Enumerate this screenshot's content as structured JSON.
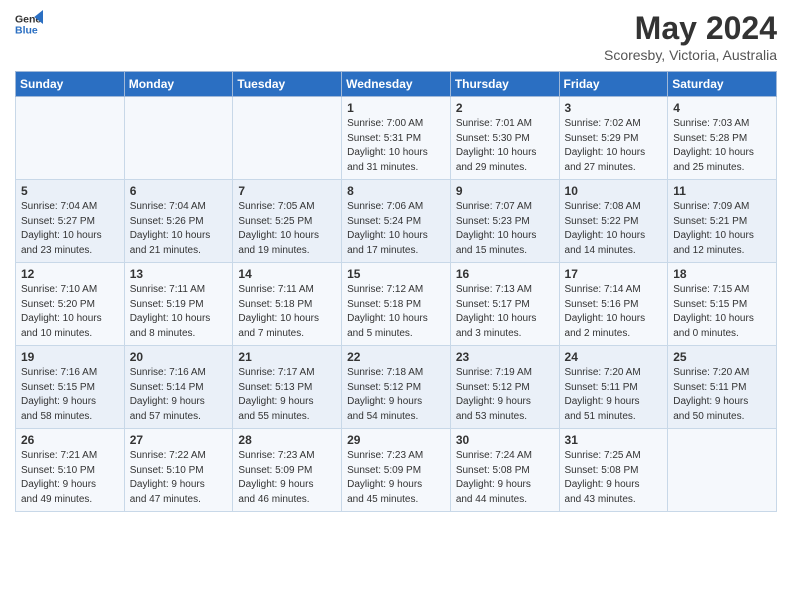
{
  "header": {
    "logo_line1": "General",
    "logo_line2": "Blue",
    "month": "May 2024",
    "location": "Scoresby, Victoria, Australia"
  },
  "days_of_week": [
    "Sunday",
    "Monday",
    "Tuesday",
    "Wednesday",
    "Thursday",
    "Friday",
    "Saturday"
  ],
  "weeks": [
    [
      {
        "day": "",
        "info": ""
      },
      {
        "day": "",
        "info": ""
      },
      {
        "day": "",
        "info": ""
      },
      {
        "day": "1",
        "info": "Sunrise: 7:00 AM\nSunset: 5:31 PM\nDaylight: 10 hours\nand 31 minutes."
      },
      {
        "day": "2",
        "info": "Sunrise: 7:01 AM\nSunset: 5:30 PM\nDaylight: 10 hours\nand 29 minutes."
      },
      {
        "day": "3",
        "info": "Sunrise: 7:02 AM\nSunset: 5:29 PM\nDaylight: 10 hours\nand 27 minutes."
      },
      {
        "day": "4",
        "info": "Sunrise: 7:03 AM\nSunset: 5:28 PM\nDaylight: 10 hours\nand 25 minutes."
      }
    ],
    [
      {
        "day": "5",
        "info": "Sunrise: 7:04 AM\nSunset: 5:27 PM\nDaylight: 10 hours\nand 23 minutes."
      },
      {
        "day": "6",
        "info": "Sunrise: 7:04 AM\nSunset: 5:26 PM\nDaylight: 10 hours\nand 21 minutes."
      },
      {
        "day": "7",
        "info": "Sunrise: 7:05 AM\nSunset: 5:25 PM\nDaylight: 10 hours\nand 19 minutes."
      },
      {
        "day": "8",
        "info": "Sunrise: 7:06 AM\nSunset: 5:24 PM\nDaylight: 10 hours\nand 17 minutes."
      },
      {
        "day": "9",
        "info": "Sunrise: 7:07 AM\nSunset: 5:23 PM\nDaylight: 10 hours\nand 15 minutes."
      },
      {
        "day": "10",
        "info": "Sunrise: 7:08 AM\nSunset: 5:22 PM\nDaylight: 10 hours\nand 14 minutes."
      },
      {
        "day": "11",
        "info": "Sunrise: 7:09 AM\nSunset: 5:21 PM\nDaylight: 10 hours\nand 12 minutes."
      }
    ],
    [
      {
        "day": "12",
        "info": "Sunrise: 7:10 AM\nSunset: 5:20 PM\nDaylight: 10 hours\nand 10 minutes."
      },
      {
        "day": "13",
        "info": "Sunrise: 7:11 AM\nSunset: 5:19 PM\nDaylight: 10 hours\nand 8 minutes."
      },
      {
        "day": "14",
        "info": "Sunrise: 7:11 AM\nSunset: 5:18 PM\nDaylight: 10 hours\nand 7 minutes."
      },
      {
        "day": "15",
        "info": "Sunrise: 7:12 AM\nSunset: 5:18 PM\nDaylight: 10 hours\nand 5 minutes."
      },
      {
        "day": "16",
        "info": "Sunrise: 7:13 AM\nSunset: 5:17 PM\nDaylight: 10 hours\nand 3 minutes."
      },
      {
        "day": "17",
        "info": "Sunrise: 7:14 AM\nSunset: 5:16 PM\nDaylight: 10 hours\nand 2 minutes."
      },
      {
        "day": "18",
        "info": "Sunrise: 7:15 AM\nSunset: 5:15 PM\nDaylight: 10 hours\nand 0 minutes."
      }
    ],
    [
      {
        "day": "19",
        "info": "Sunrise: 7:16 AM\nSunset: 5:15 PM\nDaylight: 9 hours\nand 58 minutes."
      },
      {
        "day": "20",
        "info": "Sunrise: 7:16 AM\nSunset: 5:14 PM\nDaylight: 9 hours\nand 57 minutes."
      },
      {
        "day": "21",
        "info": "Sunrise: 7:17 AM\nSunset: 5:13 PM\nDaylight: 9 hours\nand 55 minutes."
      },
      {
        "day": "22",
        "info": "Sunrise: 7:18 AM\nSunset: 5:12 PM\nDaylight: 9 hours\nand 54 minutes."
      },
      {
        "day": "23",
        "info": "Sunrise: 7:19 AM\nSunset: 5:12 PM\nDaylight: 9 hours\nand 53 minutes."
      },
      {
        "day": "24",
        "info": "Sunrise: 7:20 AM\nSunset: 5:11 PM\nDaylight: 9 hours\nand 51 minutes."
      },
      {
        "day": "25",
        "info": "Sunrise: 7:20 AM\nSunset: 5:11 PM\nDaylight: 9 hours\nand 50 minutes."
      }
    ],
    [
      {
        "day": "26",
        "info": "Sunrise: 7:21 AM\nSunset: 5:10 PM\nDaylight: 9 hours\nand 49 minutes."
      },
      {
        "day": "27",
        "info": "Sunrise: 7:22 AM\nSunset: 5:10 PM\nDaylight: 9 hours\nand 47 minutes."
      },
      {
        "day": "28",
        "info": "Sunrise: 7:23 AM\nSunset: 5:09 PM\nDaylight: 9 hours\nand 46 minutes."
      },
      {
        "day": "29",
        "info": "Sunrise: 7:23 AM\nSunset: 5:09 PM\nDaylight: 9 hours\nand 45 minutes."
      },
      {
        "day": "30",
        "info": "Sunrise: 7:24 AM\nSunset: 5:08 PM\nDaylight: 9 hours\nand 44 minutes."
      },
      {
        "day": "31",
        "info": "Sunrise: 7:25 AM\nSunset: 5:08 PM\nDaylight: 9 hours\nand 43 minutes."
      },
      {
        "day": "",
        "info": ""
      }
    ]
  ]
}
